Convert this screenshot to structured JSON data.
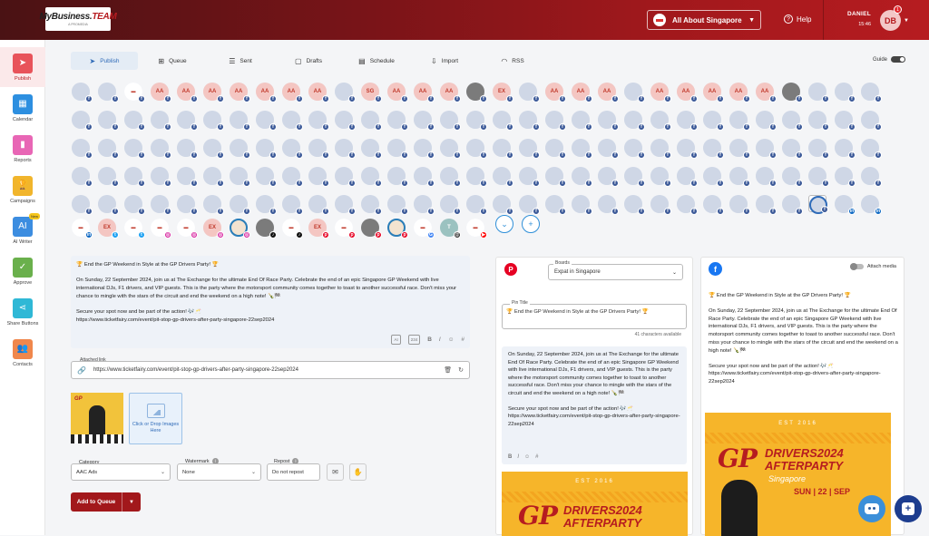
{
  "brand": {
    "logo_text_a": "MyBusiness.",
    "logo_text_b": "TEAM",
    "logo_sub": "A PROMEDIA"
  },
  "header": {
    "account": "All About Singapore",
    "help": "Help",
    "user_name": "DANIEL",
    "time": "15:46",
    "avatar_initials": "DB",
    "notifications": "1"
  },
  "sidebar": [
    {
      "label": "Publish",
      "icon": "paper-plane-icon",
      "color": "#e8535a"
    },
    {
      "label": "Calendar",
      "icon": "calendar-icon",
      "color": "#2d8fe0"
    },
    {
      "label": "Reports",
      "icon": "bar-chart-icon",
      "color": "#e866b5"
    },
    {
      "label": "Campaigns",
      "icon": "trophy-icon",
      "color": "#f1b52c"
    },
    {
      "label": "AI Writer",
      "icon": "ai-icon",
      "color": "#3c8de0",
      "badge": "New"
    },
    {
      "label": "Approve",
      "icon": "approve-icon",
      "color": "#6ab04c"
    },
    {
      "label": "Share Buttons",
      "icon": "share-icon",
      "color": "#2fb8d6"
    },
    {
      "label": "Contacts",
      "icon": "contacts-icon",
      "color": "#f0874c"
    }
  ],
  "tabs": [
    {
      "label": "Publish",
      "icon": "paper-plane-icon",
      "active": true
    },
    {
      "label": "Queue",
      "icon": "queue-icon",
      "active": false
    },
    {
      "label": "Sent",
      "icon": "list-icon",
      "active": false
    },
    {
      "label": "Drafts",
      "icon": "draft-icon",
      "active": false
    },
    {
      "label": "Schedule",
      "icon": "schedule-icon",
      "active": false
    },
    {
      "label": "Import",
      "icon": "import-icon",
      "active": false
    },
    {
      "label": "RSS",
      "icon": "rss-icon",
      "active": false
    }
  ],
  "guide_label": "Guide",
  "profile_grid": {
    "row1": [
      "img",
      "img",
      "stamp",
      "AA",
      "AA",
      "AA",
      "AA",
      "AA",
      "AA",
      "AA",
      "img",
      "SG",
      "AA",
      "AA",
      "AA",
      "grey",
      "EX",
      "img",
      "AA",
      "AA",
      "AA",
      "img",
      "AA",
      "AA",
      "AA",
      "AA",
      "AA",
      "grey",
      "f",
      "f",
      "f"
    ],
    "rows_blank": "f",
    "last_row": [
      {
        "t": "stamp",
        "s": "in"
      },
      {
        "t": "EX",
        "s": "tw"
      },
      {
        "t": "stamp",
        "s": "tw"
      },
      {
        "t": "stamp",
        "s": "ig"
      },
      {
        "t": "stamp",
        "s": "ig"
      },
      {
        "t": "EX",
        "s": "ig"
      },
      {
        "t": "ring",
        "s": "ig"
      },
      {
        "t": "grey",
        "s": "tk"
      },
      {
        "t": "stamp",
        "s": "tk"
      },
      {
        "t": "EX",
        "s": "pi"
      },
      {
        "t": "stamp",
        "s": "pi"
      },
      {
        "t": "grey",
        "s": "pi"
      },
      {
        "t": "ring",
        "s": "pi"
      },
      {
        "t": "stamp",
        "s": "gm"
      },
      {
        "t": "teal",
        "s": "th"
      },
      {
        "t": "stamp",
        "s": "yt"
      }
    ]
  },
  "editor": {
    "headline": "🏆 End the GP Weekend in Style at the GP Drivers Party! 🏆",
    "body": "On Sunday, 22 September 2024, join us at The Exchange for the ultimate End Of Race Party. Celebrate the end of an epic Singapore GP Weekend with live international DJs, F1 drivers, and VIP guests. This is the party where the motorsport community comes together to toast to another successful race. Don't miss your chance to mingle with the stars of the circuit and end the weekend on a high note! 🍾🏁",
    "cta": "Secure your spot now and be part of the action! 🎶🥂",
    "url": "https://www.ticketfairy.com/event/pit-stop-gp-drivers-after-party-singapore-22sep2024"
  },
  "attached_link": {
    "label": "Attached link",
    "value": "https://www.ticketfairy.com/event/pit-stop-gp-drivers-after-party-singapore-22sep2024"
  },
  "thumb": {
    "title": "GP"
  },
  "dropzone": "Click or Drop Images Here",
  "fields": {
    "category_label": "Category",
    "category_value": "AAC Ads",
    "watermark_label": "Watermark",
    "watermark_value": "None",
    "repost_label": "Repost",
    "repost_value": "Do not repost"
  },
  "queue_button": "Add to Queue",
  "pinterest": {
    "boards_label": "Boards",
    "board_value": "Expat in Singapore",
    "pin_title_label": "Pin Title",
    "pin_title": "🏆 End the GP Weekend in Style at the GP Drivers Party! 🏆",
    "chars_left": "41 characters available",
    "desc_body": "On Sunday, 22 September 2024, join us at The Exchange for the ultimate End Of Race Party. Celebrate the end of an epic Singapore GP Weekend with live international DJs, F1 drivers, and VIP guests. This is the party where the motorsport community comes together to toast to another successful race. Don't miss your chance to mingle with the stars of the circuit and end the weekend on a high note! 🍾🏁",
    "desc_cta": "Secure your spot now and be part of the action! 🎶🥂",
    "desc_url": "https://www.ticketfairy.com/event/pit-stop-gp-drivers-after-party-singapore-22sep2024"
  },
  "facebook": {
    "attach_media": "Attach media",
    "headline": "🏆 End the GP Weekend in Style at the GP Drivers Party! 🏆",
    "body": "On Sunday, 22 September 2024, join us at The Exchange for the ultimate End Of Race Party. Celebrate the end of an epic Singapore GP Weekend with live international DJs, F1 drivers, and VIP guests. This is the party where the motorsport community comes together to toast to another successful race. Don't miss your chance to mingle with the stars of the circuit and end the weekend on a high note! 🍾🏁",
    "cta": "Secure your spot now and be part of the action! 🎶🥂",
    "url": "https://www.ticketfairy.com/event/pit-stop-gp-drivers-after-party-singapore-22sep2024"
  },
  "poster": {
    "est": "EST 2016",
    "gp": "GP",
    "drivers": "DRIVERS2024",
    "after": "AFTERPARTY",
    "city": "Singapore",
    "date": "SUN | 22 | SEP"
  }
}
